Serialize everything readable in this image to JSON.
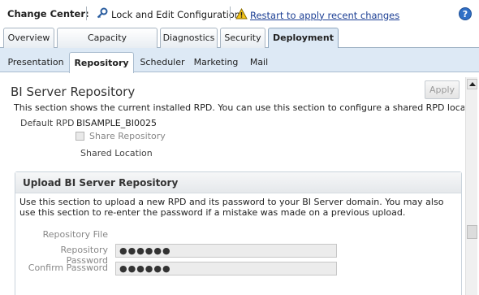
{
  "change_center": {
    "label": "Change Center:",
    "lock_edit_label": "Lock and Edit Configuration",
    "restart_link": "Restart to apply recent changes",
    "help_glyph": "?",
    "icons": [
      "key-icon",
      "warning-icon",
      "help-icon"
    ]
  },
  "main_tabs": [
    {
      "label": "Overview",
      "active": false
    },
    {
      "label": "Capacity Management",
      "active": false
    },
    {
      "label": "Diagnostics",
      "active": false
    },
    {
      "label": "Security",
      "active": false
    },
    {
      "label": "Deployment",
      "active": true
    }
  ],
  "sub_tabs": [
    {
      "label": "Presentation",
      "active": false
    },
    {
      "label": "Repository",
      "active": true
    },
    {
      "label": "Scheduler",
      "active": false
    },
    {
      "label": "Marketing",
      "active": false
    },
    {
      "label": "Mail",
      "active": false
    }
  ],
  "repository": {
    "title": "BI Server Repository",
    "apply_label": "Apply",
    "description": "This section shows the current installed RPD. You can use this section to configure a shared RPD location.",
    "default_rpd_label": "Default RPD",
    "default_rpd_value": "BISAMPLE_BI0025",
    "share_repository_label": "Share Repository",
    "share_repository_checked": false,
    "shared_location_label": "Shared Location"
  },
  "upload": {
    "title": "Upload BI Server Repository",
    "description": "Use this section to upload a new RPD and its password to your BI Server domain. You may also use this section to re-enter the password if a mistake was made on a previous upload.",
    "repository_file_label": "Repository File",
    "repository_password_label": "Repository Password",
    "repository_password_value": "●●●●●●",
    "confirm_password_label": "Confirm Password",
    "confirm_password_value": "●●●●●●"
  },
  "colors": {
    "accent_blue": "#2f6fc6",
    "tab_bar": "#dde9f5",
    "link": "#1c3f94"
  }
}
